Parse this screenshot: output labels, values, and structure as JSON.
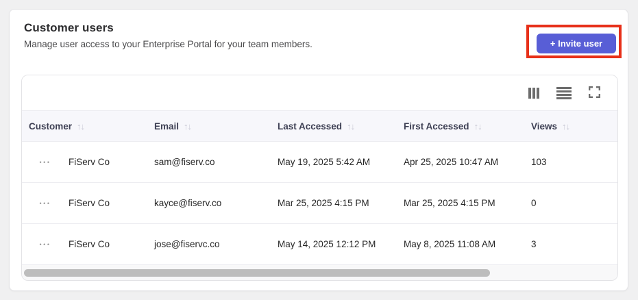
{
  "page": {
    "title": "Customer users",
    "subtitle": "Manage user access to your Enterprise Portal for your team members."
  },
  "invite_button": {
    "label": "+ Invite user"
  },
  "colors": {
    "accent": "#585ed6",
    "highlight_border": "#e73019",
    "header_bg": "#f7f7fb",
    "page_bg": "#f0f0f1"
  },
  "icons": {
    "sort_glyph": "↑↓",
    "row_menu_glyph": "•••",
    "toolbar": [
      "columns-icon",
      "density-icon",
      "fullscreen-icon"
    ]
  },
  "table": {
    "columns": [
      {
        "label": "Customer"
      },
      {
        "label": "Email"
      },
      {
        "label": "Last Accessed"
      },
      {
        "label": "First Accessed"
      },
      {
        "label": "Views"
      }
    ],
    "rows": [
      {
        "customer": "FiServ Co",
        "email": "sam@fiserv.co",
        "last_accessed": "May 19, 2025 5:42 AM",
        "first_accessed": "Apr 25, 2025 10:47 AM",
        "views": "103"
      },
      {
        "customer": "FiServ Co",
        "email": "kayce@fiserv.co",
        "last_accessed": "Mar 25, 2025 4:15 PM",
        "first_accessed": "Mar 25, 2025 4:15 PM",
        "views": "0"
      },
      {
        "customer": "FiServ Co",
        "email": "jose@fiservc.co",
        "last_accessed": "May 14, 2025 12:12 PM",
        "first_accessed": "May 8, 2025 11:08 AM",
        "views": "3"
      }
    ]
  }
}
